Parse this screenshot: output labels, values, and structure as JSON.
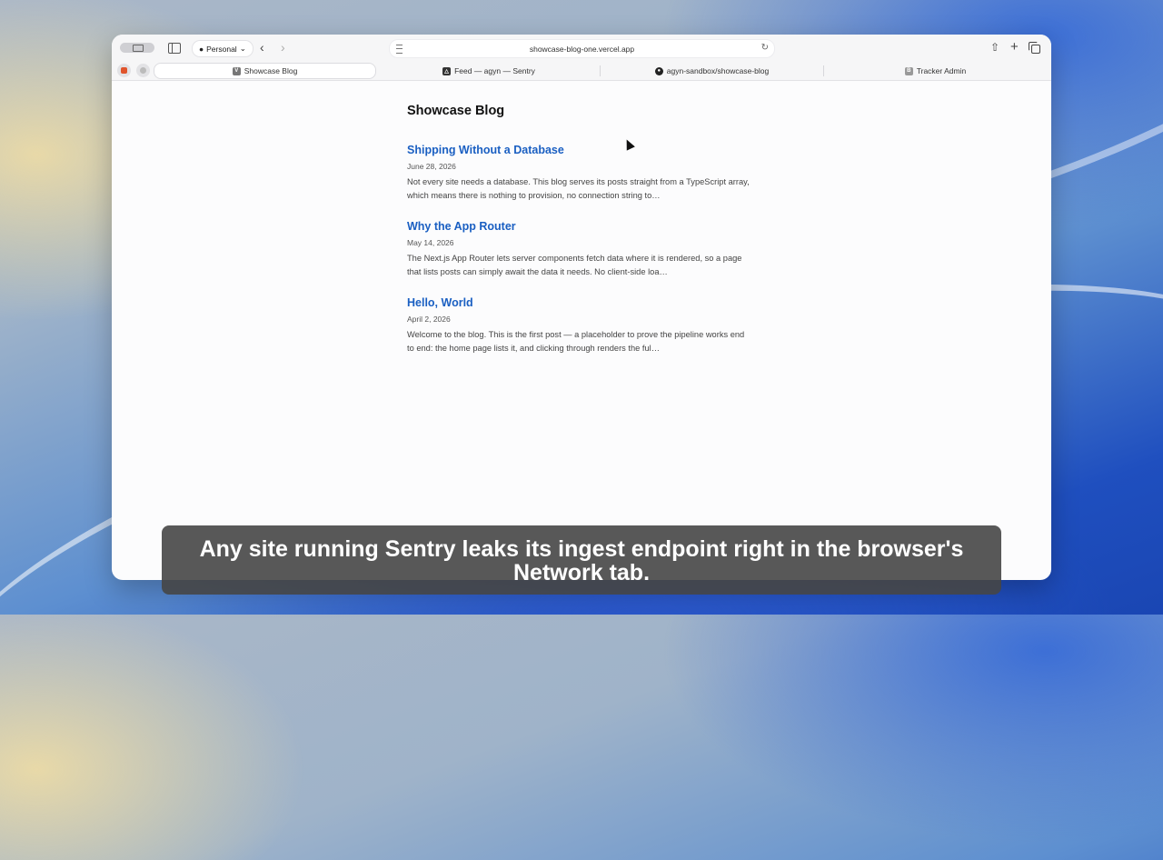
{
  "browser": {
    "profile_label": "Personal",
    "address_url": "showcase-blog-one.vercel.app",
    "tabs": [
      {
        "label": "Showcase Blog",
        "icon": "vercel-favicon",
        "icon_char": "V",
        "active": true
      },
      {
        "label": "Feed — agyn — Sentry",
        "icon": "sentry-favicon",
        "icon_char": "△",
        "active": false
      },
      {
        "label": "agyn-sandbox/showcase-blog",
        "icon": "github-favicon",
        "icon_char": "●",
        "active": false
      },
      {
        "label": "Tracker Admin",
        "icon": "tracker-favicon",
        "icon_char": "B",
        "active": false
      }
    ],
    "colors": {
      "accent": "#1a5fc2"
    }
  },
  "page": {
    "site_title": "Showcase Blog",
    "posts": [
      {
        "title": "Shipping Without a Database",
        "date": "June 28, 2026",
        "excerpt": "Not every site needs a database. This blog serves its posts straight from a TypeScript array, which means there is nothing to provision, no connection string to…"
      },
      {
        "title": "Why the App Router",
        "date": "May 14, 2026",
        "excerpt": "The Next.js App Router lets server components fetch data where it is rendered, so a page that lists posts can simply await the data it needs. No client-side loa…"
      },
      {
        "title": "Hello, World",
        "date": "April 2, 2026",
        "excerpt": "Welcome to the blog. This is the first post — a placeholder to prove the pipeline works end to end: the home page lists it, and clicking through renders the ful…"
      }
    ]
  },
  "caption": {
    "text": "Any site running Sentry leaks its ingest endpoint right in the browser's Network tab."
  }
}
